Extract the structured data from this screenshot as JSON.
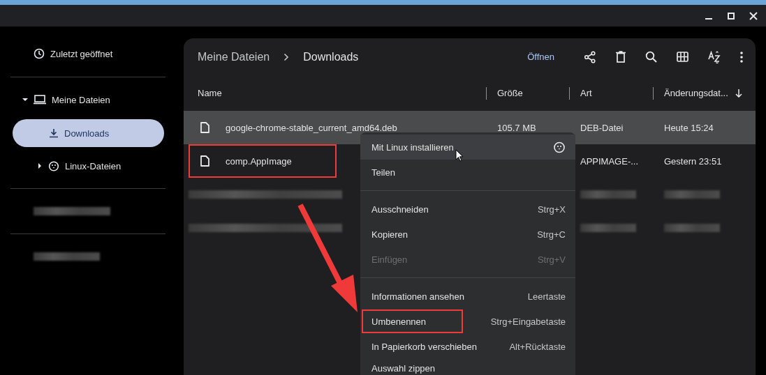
{
  "sidebar": {
    "recent": {
      "label": "Zuletzt geöffnet"
    },
    "tree": [
      {
        "label": "Meine Dateien",
        "kind": "computer",
        "expanded": true,
        "children": [
          {
            "label": "Downloads",
            "kind": "download",
            "selected": true
          },
          {
            "label": "Linux-Dateien",
            "kind": "linux",
            "selected": false,
            "expanded": false
          }
        ]
      }
    ],
    "redacted_sections": [
      {
        "redacted": true
      },
      {
        "redacted": true
      }
    ]
  },
  "breadcrumb": [
    "Meine Dateien",
    "Downloads"
  ],
  "toolbar": {
    "open_label": "Öffnen"
  },
  "table": {
    "columns": [
      {
        "label": "Name",
        "sorted": false
      },
      {
        "label": "Größe",
        "sorted": false
      },
      {
        "label": "Art",
        "sorted": false
      },
      {
        "label": "Änderungsdat...",
        "sorted": true
      }
    ],
    "rows": [
      {
        "name": "google-chrome-stable_current_amd64.deb",
        "size": "105.7 MB",
        "type": "DEB-Datei",
        "modified": "Heute 15:24",
        "selected": true,
        "highlighted": false
      },
      {
        "name": "comp.AppImage",
        "type": "APPIMAGE-...",
        "modified": "Gestern 23:51",
        "selected": false,
        "highlighted": true
      },
      {
        "selected": false,
        "redacted": true
      },
      {
        "selected": false,
        "redacted": true
      }
    ]
  },
  "context_menu": [
    {
      "kind": "app-item",
      "label": "Mit Linux installieren",
      "hovered": true,
      "disabled": false,
      "highlighted": false
    },
    {
      "kind": "item",
      "label": "Teilen",
      "hovered": false,
      "disabled": false,
      "highlighted": false
    },
    {
      "kind": "divider"
    },
    {
      "kind": "item",
      "label": "Ausschneiden",
      "shortcut": "Strg+X",
      "hovered": false,
      "disabled": false,
      "highlighted": false
    },
    {
      "kind": "item",
      "label": "Kopieren",
      "shortcut": "Strg+C",
      "hovered": false,
      "disabled": false,
      "highlighted": false
    },
    {
      "kind": "item",
      "label": "Einfügen",
      "shortcut": "Strg+V",
      "hovered": false,
      "disabled": true,
      "highlighted": false
    },
    {
      "kind": "divider"
    },
    {
      "kind": "item",
      "label": "Informationen ansehen",
      "shortcut": "Leertaste",
      "hovered": false,
      "disabled": false,
      "highlighted": false
    },
    {
      "kind": "item",
      "label": "Umbenennen",
      "shortcut": "Strg+Eingabetaste",
      "hovered": false,
      "disabled": false,
      "highlighted": true
    },
    {
      "kind": "item",
      "label": "In Papierkorb verschieben",
      "shortcut": "Alt+Rücktaste",
      "hovered": false,
      "disabled": false,
      "highlighted": false
    },
    {
      "kind": "item",
      "label": "Auswahl zippen",
      "hovered": false,
      "disabled": false,
      "highlighted": false
    }
  ]
}
